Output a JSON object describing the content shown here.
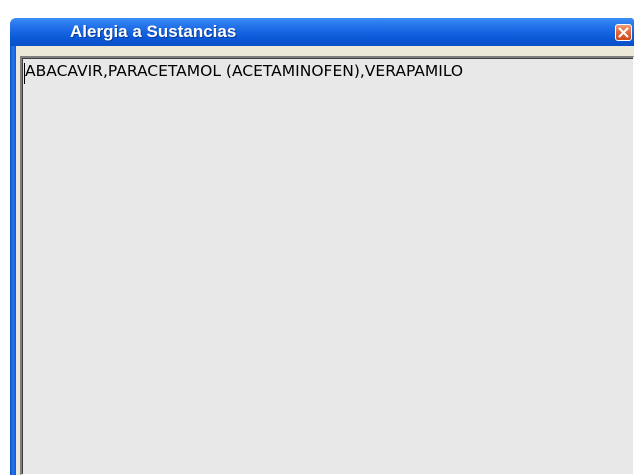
{
  "window": {
    "title": "Alergia a Sustancias",
    "close_icon": "close-icon"
  },
  "memo": {
    "value": "ABACAVIR,PARACETAMOL (ACETAMINOFEN),VERAPAMILO"
  },
  "colors": {
    "titlebar": "#0b5ad9",
    "close_button": "#e0602f",
    "client_background": "#e8e8e8"
  }
}
